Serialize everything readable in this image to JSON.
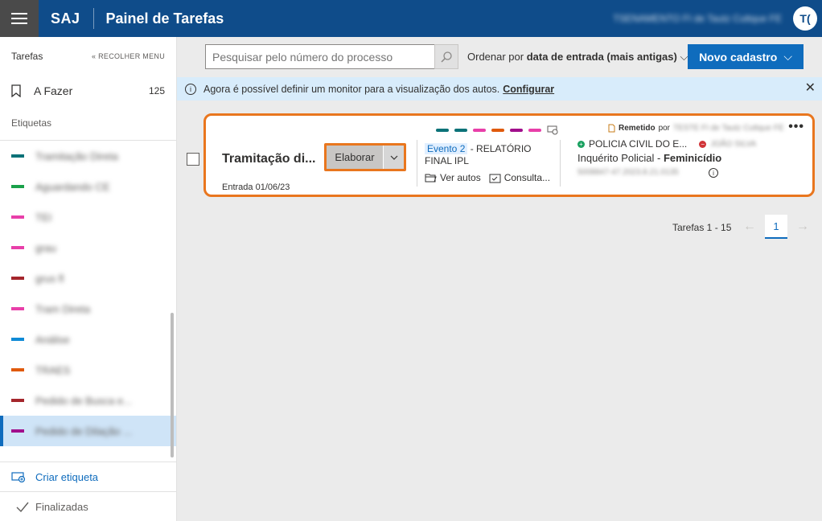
{
  "header": {
    "brand": "SAJ",
    "title": "Painel de Tarefas",
    "user_name": "TSENAMENTO FI de Tautz Cuttque FE",
    "avatar_initials": "T("
  },
  "sidebar": {
    "section_title": "Tarefas",
    "collapse_label": "« RECOLHER MENU",
    "todo_label": "A Fazer",
    "todo_count": "125",
    "tags_title": "Etiquetas",
    "tags": [
      {
        "name": "Tramitação Direta",
        "color": "#0b7278"
      },
      {
        "name": "Aguardando CE",
        "color": "#1aa14a"
      },
      {
        "name": "TEI",
        "color": "#e83fa9"
      },
      {
        "name": "grau",
        "color": "#e83fa9"
      },
      {
        "name": "grus fl",
        "color": "#a4262c"
      },
      {
        "name": "Tram Direta",
        "color": "#e83fa9"
      },
      {
        "name": "Análise",
        "color": "#0f8ad6"
      },
      {
        "name": "TRAES",
        "color": "#e05a0c"
      },
      {
        "name": "Pedido de Busca e...",
        "color": "#a4262c"
      },
      {
        "name": "Pedido de Dilação ...",
        "color": "#a10f8c"
      }
    ],
    "create_tag_label": "Criar etiqueta",
    "finished_label": "Finalizadas"
  },
  "toolbar": {
    "search_placeholder": "Pesquisar pelo número do processo",
    "order_prefix": "Ordenar por",
    "order_value": "data de entrada (mais antigas)",
    "new_button_label": "Novo cadastro"
  },
  "infobar": {
    "message": "Agora é possível definir um monitor para a visualização dos autos.",
    "link_label": "Configurar"
  },
  "task": {
    "title": "Tramitação di...",
    "entry_date": "Entrada 01/06/23",
    "action_label": "Elaborar",
    "color_dots": [
      "#0b7278",
      "#0b7278",
      "#e83fa9",
      "#e05a0c",
      "#a10f8c",
      "#e83fa9"
    ],
    "event_badge": "Evento 2",
    "event_desc": " - RELATÓRIO FINAL IPL",
    "view_label": "Ver autos",
    "consult_label": "Consulta...",
    "remetido_label": "Remetido",
    "remetido_by": "por",
    "remetido_name": "TESTE FI de Tautz Cuttque FE",
    "party_active": "POLICIA CIVIL DO E...",
    "party_passive": "JOÃO SILVA",
    "class_name": "Inquérito Policial",
    "class_sep": " - ",
    "subject": "Feminicídio",
    "process_number": "5008847-47.2023.8.21.0135"
  },
  "pagination": {
    "label": "Tarefas 1 - 15",
    "current_page": "1"
  }
}
